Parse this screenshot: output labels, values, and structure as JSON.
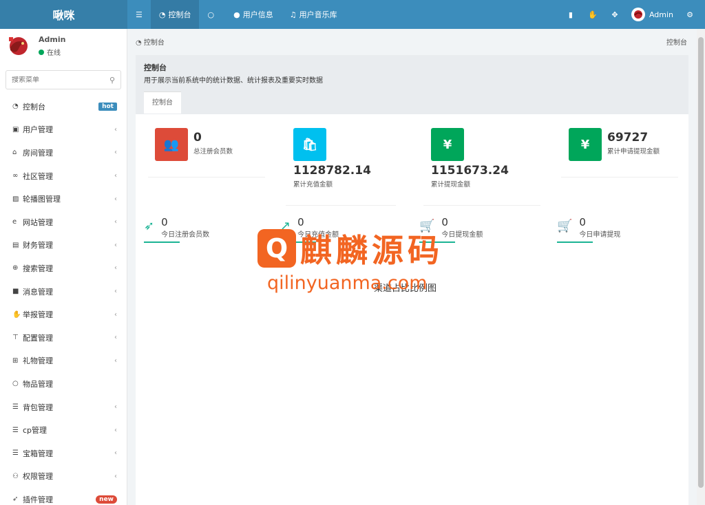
{
  "brand": "啾咪",
  "topnav": {
    "menu_icon": "hamburger-icon",
    "items": [
      {
        "label": "控制台",
        "icon": "dashboard-icon"
      },
      {
        "label": "",
        "icon": "circle-icon"
      },
      {
        "label": "用户信息",
        "icon": "user-icon"
      },
      {
        "label": "用户音乐库",
        "icon": "music-icon"
      }
    ],
    "right_icons": [
      "trash-icon",
      "language-icon",
      "fullscreen-icon"
    ],
    "user_name": "Admin",
    "settings_icon": "cogs-icon"
  },
  "sidebar": {
    "user": {
      "name": "Admin",
      "status": "在线",
      "status_color": "#00a65a"
    },
    "search_placeholder": "搜索菜单",
    "items": [
      {
        "label": "控制台",
        "icon": "dashboard-icon",
        "badge": "hot"
      },
      {
        "label": "用户管理",
        "icon": "user-square-icon"
      },
      {
        "label": "房间管理",
        "icon": "bank-icon"
      },
      {
        "label": "社区管理",
        "icon": "binoculars-icon"
      },
      {
        "label": "轮播图管理",
        "icon": "image-icon"
      },
      {
        "label": "网站管理",
        "icon": "ie-icon"
      },
      {
        "label": "财务管理",
        "icon": "money-icon"
      },
      {
        "label": "搜索管理",
        "icon": "search-plus-icon"
      },
      {
        "label": "消息管理",
        "icon": "message-icon"
      },
      {
        "label": "举报管理",
        "icon": "hand-icon"
      },
      {
        "label": "配置管理",
        "icon": "sitemap-icon"
      },
      {
        "label": "礼物管理",
        "icon": "gift-icon"
      },
      {
        "label": "物品管理",
        "icon": "circle-icon"
      },
      {
        "label": "背包管理",
        "icon": "list-icon"
      },
      {
        "label": "cp管理",
        "icon": "list-icon"
      },
      {
        "label": "宝箱管理",
        "icon": "list-icon"
      },
      {
        "label": "权限管理",
        "icon": "group-icon"
      },
      {
        "label": "插件管理",
        "icon": "rocket-icon",
        "badge": "new"
      }
    ]
  },
  "breadcrumb": {
    "left": "控制台",
    "right": "控制台"
  },
  "panel": {
    "title": "控制台",
    "description": "用于展示当前系统中的统计数据、统计报表及重要实时数据",
    "tab": "控制台"
  },
  "stats": [
    {
      "value": "0",
      "label": "总注册会员数",
      "icon": "users-icon",
      "color": "#dd4b39"
    },
    {
      "value": "1128782.14",
      "label": "累计充值金额",
      "icon": "shopping-bag-icon",
      "color": "#00c0ef"
    },
    {
      "value": "1151673.24",
      "label": "累计提现金额",
      "icon": "yen-icon",
      "color": "#00a65a"
    },
    {
      "value": "69727",
      "label": "累计申请提现金额",
      "icon": "yen-icon",
      "color": "#00a65a"
    }
  ],
  "today": [
    {
      "value": "0",
      "label": "今日注册会员数",
      "icon": "rocket-icon"
    },
    {
      "value": "0",
      "label": "今日充值金额",
      "icon": "line-chart-icon"
    },
    {
      "value": "0",
      "label": "今日提现金额",
      "icon": "cart-icon"
    },
    {
      "value": "0",
      "label": "今日申请提现",
      "icon": "cart-icon"
    }
  ],
  "accent_color": "#1ab394",
  "chart_title": "渠道占比比例图",
  "watermark": {
    "text": "麒麟源码",
    "url": "qilinyuanma.com",
    "color": "#f26522"
  }
}
